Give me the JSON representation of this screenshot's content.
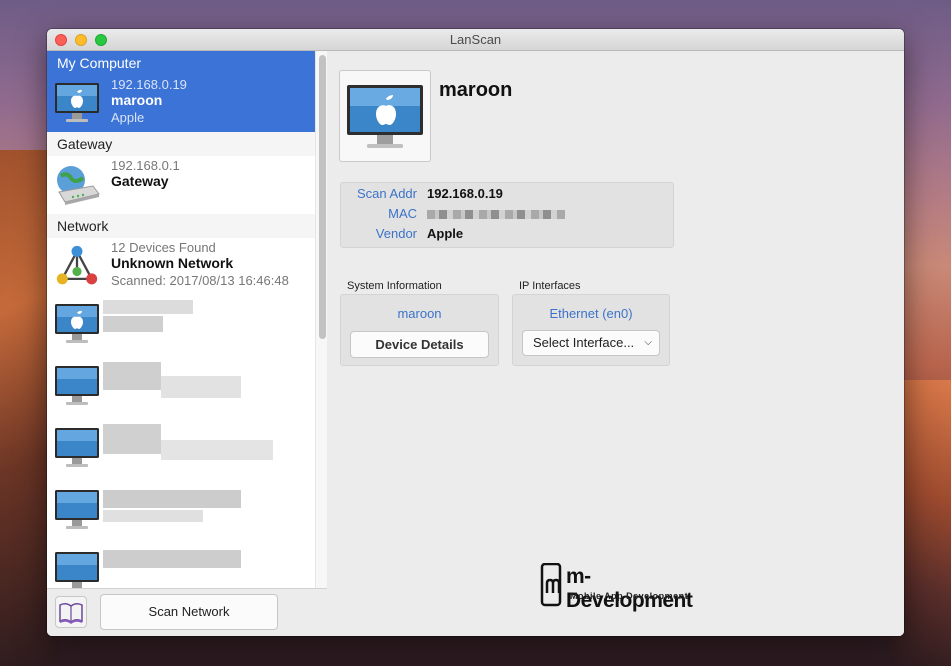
{
  "window": {
    "title": "LanScan"
  },
  "sidebar": {
    "my_computer": {
      "header": "My Computer",
      "ip": "192.168.0.19",
      "name": "maroon",
      "vendor": "Apple",
      "icon": "imac-icon"
    },
    "gateway": {
      "header": "Gateway",
      "ip": "192.168.0.1",
      "name": "Gateway",
      "icon": "router-icon"
    },
    "network": {
      "header": "Network",
      "count": "12 Devices Found",
      "name": "Unknown Network",
      "scanned": "Scanned: 2017/08/13 16:46:48",
      "icon": "network-icon"
    }
  },
  "footer": {
    "scan_button": "Scan Network",
    "book_icon": "book-icon"
  },
  "detail": {
    "name": "maroon",
    "scan_addr_label": "Scan Addr",
    "scan_addr": "192.168.0.19",
    "mac_label": "MAC",
    "vendor_label": "Vendor",
    "vendor": "Apple",
    "system_info_label": "System Information",
    "system_info_link": "maroon",
    "device_details_button": "Device Details",
    "ip_interfaces_label": "IP Interfaces",
    "ip_interface_link": "Ethernet (en0)",
    "select_interface": "Select Interface..."
  },
  "logo": {
    "main": "m-Development",
    "sub": "Mobile App Development"
  },
  "colors": {
    "selection": "#3b73d6",
    "link": "#3c73c9"
  }
}
